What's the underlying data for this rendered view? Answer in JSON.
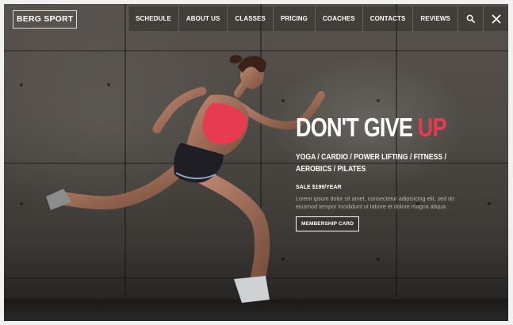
{
  "brand": {
    "logo_text": "BERG SPORT"
  },
  "nav": {
    "items": [
      "SCHEDULE",
      "ABOUT US",
      "CLASSES",
      "PRICING",
      "COACHES",
      "CONTACTS",
      "REVIEWS"
    ],
    "search_icon": "search-icon",
    "close_icon": "close-icon"
  },
  "hero": {
    "headline_main": "DON'T GIVE ",
    "headline_accent": "UP",
    "tags": "YOGA / CARDIO / POWER LIFTING / FITNESS / AEROBICS / PILATES",
    "sale": "SALE $199/YEAR",
    "description": "Lorem ipsum dolor sit amet, consectetur adipisicing elit, sed do eiusmod tempor incididunt ut labore et dolore magna aliqua.",
    "cta_label": "MEMBERSHIP CARD"
  },
  "colors": {
    "accent": "#ea3a4f",
    "text": "#ffffff",
    "muted": "#b8b4ae"
  }
}
